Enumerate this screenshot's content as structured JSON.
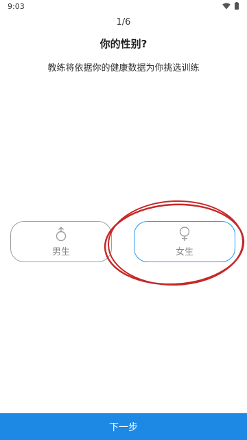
{
  "status_bar": {
    "time": "9:03",
    "icons": [
      "wifi-icon",
      "battery-icon"
    ]
  },
  "header": {
    "step": "1/6",
    "title": "你的性别?",
    "subtitle": "教练将依据你的健康数据为你挑选训练"
  },
  "gender_options": [
    {
      "label": "男生",
      "icon": "male-icon",
      "selected": false
    },
    {
      "label": "女生",
      "icon": "female-icon",
      "selected": true
    }
  ],
  "footer": {
    "next_label": "下一步"
  },
  "colors": {
    "accent": "#1e88e5",
    "selected_border": "#2196F3",
    "unselected_border": "#9e9e9e",
    "annotation": "#c62828"
  }
}
